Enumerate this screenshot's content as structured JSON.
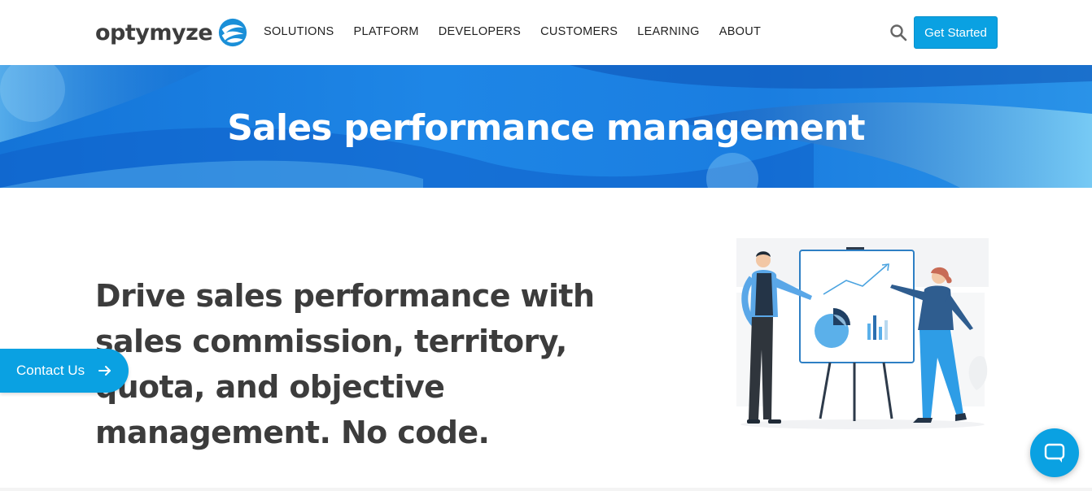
{
  "header": {
    "logo_text": "optymyze",
    "nav": [
      {
        "label": "SOLUTIONS"
      },
      {
        "label": "PLATFORM"
      },
      {
        "label": "DEVELOPERS"
      },
      {
        "label": "CUSTOMERS"
      },
      {
        "label": "LEARNING"
      },
      {
        "label": "ABOUT"
      }
    ],
    "search_icon": "search-icon",
    "cta_label": "Get Started"
  },
  "banner": {
    "title": "Sales performance management"
  },
  "main": {
    "headline": "Drive sales performance with sales commission, territory, quota, and objective management. No code."
  },
  "contact_tab": {
    "label": "Contact Us",
    "icon": "arrow-right-icon"
  },
  "chat": {
    "icon": "chat-bubble-icon"
  },
  "colors": {
    "accent": "#0aa1e2",
    "banner_blue": "#1a7de0",
    "text_dark": "#3c3c3c"
  }
}
